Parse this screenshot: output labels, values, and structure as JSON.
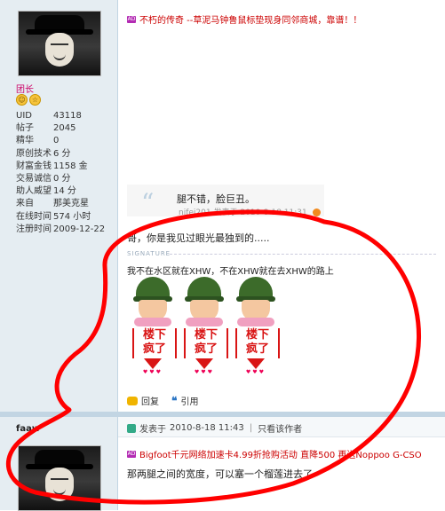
{
  "post1": {
    "rank": "团长",
    "stats": [
      {
        "label": "UID",
        "value": "43118"
      },
      {
        "label": "帖子",
        "value": "2045"
      },
      {
        "label": "精华",
        "value": "0"
      },
      {
        "label": "原创技术",
        "value": "6 分"
      },
      {
        "label": "财富金钱",
        "value": "1158 金"
      },
      {
        "label": "交易诚信",
        "value": "0 分"
      },
      {
        "label": "助人威望",
        "value": "14 分"
      },
      {
        "label": "来自",
        "value": "那美克星"
      },
      {
        "label": "在线时间",
        "value": "574 小时"
      },
      {
        "label": "注册时间",
        "value": "2009-12-22"
      }
    ],
    "ad": "不朽的传奇 --草泥马钟鲁鼠标垫现身同邻商城，靠谱！！",
    "quote": {
      "text": "腿不错，脸巨丑。",
      "author": "nifei201",
      "posted_prefix": "发表于",
      "time": "2010-8-18 11:31"
    },
    "body": "哥，你是我见过眼光最独到的.....",
    "signature_label": "SIGNATURE",
    "signature_text": "我不在水区就在XHW，不在XHW就在去XHW的路上",
    "sticker_text_line1": "楼下",
    "sticker_text_line2": "疯了",
    "reply_label": "回复",
    "quote_label": "引用"
  },
  "post2": {
    "username": "faaw",
    "posted_prefix": "发表于",
    "time": "2010-8-18 11:43",
    "only_author": "只看该作者",
    "ad": "Bigfoot千元网络加速卡4.99折抢购活动 直降500 再送Noppoo G-CSO",
    "body": "那两腿之间的宽度，可以塞一个榴莲进去了"
  },
  "colors": {
    "sidebar_bg": "#e5edf2",
    "link_red": "#cc0000",
    "scribble_red": "#ff0000"
  }
}
